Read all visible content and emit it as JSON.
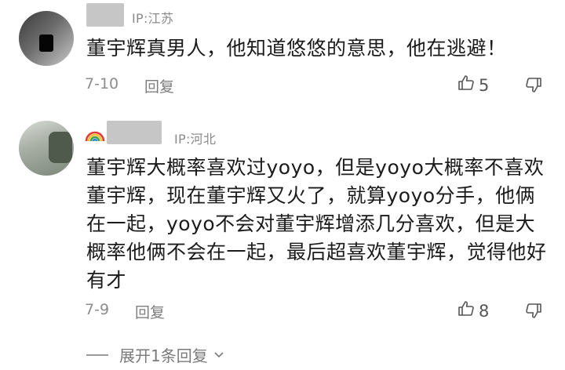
{
  "comments": [
    {
      "ip": "IP:江苏",
      "text": "董宇辉真男人，他知道悠悠的意思，他在逃避！",
      "date": "7-10",
      "reply_label": "回复",
      "likes": "5"
    },
    {
      "ip": "IP:河北",
      "text": "董宇辉大概率喜欢过yoyo，但是yoyo大概率不喜欢董宇辉，现在董宇辉又火了，就算yoyo分手，他俩在一起，yoyo不会对董宇辉增添几分喜欢，但是大概率他俩不会在一起，最后超喜欢董宇辉，觉得他好有才",
      "date": "7-9",
      "reply_label": "回复",
      "likes": "8"
    }
  ],
  "expand_label": "展开1条回复",
  "icons": {
    "like": "thumbs-up-icon",
    "dislike": "thumbs-down-icon",
    "expand": "chevron-down-icon"
  },
  "colors": {
    "text": "#1b1b1b",
    "meta": "#8c8c8c"
  }
}
